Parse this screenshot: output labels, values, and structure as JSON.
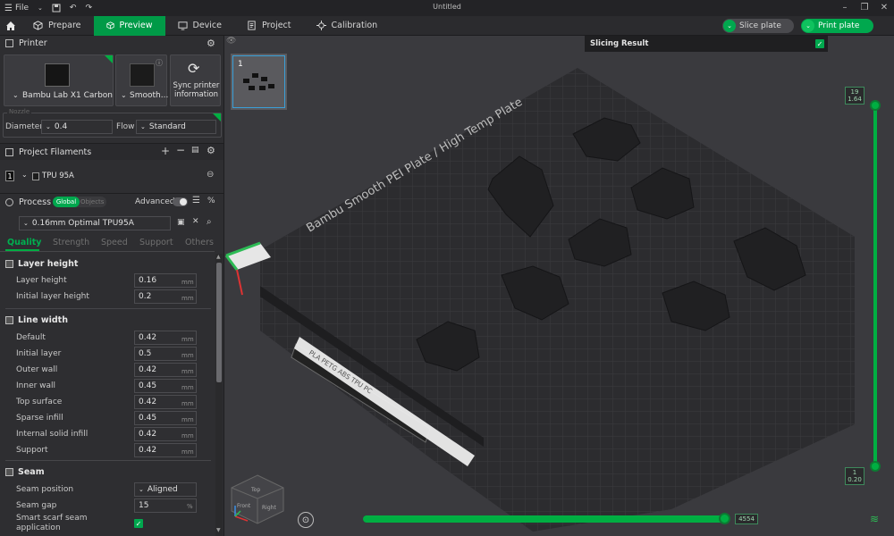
{
  "app": {
    "window_title": "Untitled",
    "file_menu_label": "File"
  },
  "toolbar": {
    "tabs": [
      {
        "label": "Prepare",
        "icon": "cube-icon"
      },
      {
        "label": "Preview",
        "icon": "cube-icon"
      },
      {
        "label": "Device",
        "icon": "device-icon"
      },
      {
        "label": "Project",
        "icon": "project-icon"
      },
      {
        "label": "Calibration",
        "icon": "calibration-icon"
      }
    ],
    "active_tab": "Preview",
    "slice_plate_label": "Slice plate",
    "print_plate_label": "Print plate"
  },
  "printer": {
    "section_title": "Printer",
    "printer_name": "Bambu Lab X1 Carbon",
    "plate_name": "Smooth...",
    "sync_label": "Sync printer information",
    "nozzle_label": "Nozzle",
    "diameter_label": "Diameter",
    "diameter_value": "0.4",
    "flow_label": "Flow",
    "flow_value": "Standard"
  },
  "filaments": {
    "section_title": "Project Filaments",
    "items": [
      {
        "index": "1",
        "name": "TPU 95A"
      }
    ]
  },
  "process": {
    "section_title": "Process",
    "toggle_global": "Global",
    "toggle_objects": "Objects",
    "advanced_label": "Advanced",
    "profile": "0.16mm Optimal TPU95A",
    "subtabs": [
      "Quality",
      "Strength",
      "Speed",
      "Support",
      "Others"
    ],
    "active_subtab": "Quality",
    "groups": [
      {
        "title": "Layer height",
        "rows": [
          {
            "label": "Layer height",
            "value": "0.16",
            "unit": "mm"
          },
          {
            "label": "Initial layer height",
            "value": "0.2",
            "unit": "mm"
          }
        ]
      },
      {
        "title": "Line width",
        "rows": [
          {
            "label": "Default",
            "value": "0.42",
            "unit": "mm"
          },
          {
            "label": "Initial layer",
            "value": "0.5",
            "unit": "mm"
          },
          {
            "label": "Outer wall",
            "value": "0.42",
            "unit": "mm"
          },
          {
            "label": "Inner wall",
            "value": "0.45",
            "unit": "mm"
          },
          {
            "label": "Top surface",
            "value": "0.42",
            "unit": "mm"
          },
          {
            "label": "Sparse infill",
            "value": "0.45",
            "unit": "mm"
          },
          {
            "label": "Internal solid infill",
            "value": "0.42",
            "unit": "mm"
          },
          {
            "label": "Support",
            "value": "0.42",
            "unit": "mm"
          }
        ]
      },
      {
        "title": "Seam",
        "rows": [
          {
            "label": "Seam position",
            "value": "Aligned",
            "unit": ""
          },
          {
            "label": "Seam gap",
            "value": "15",
            "unit": "%"
          },
          {
            "label": "Smart scarf seam application",
            "value": "",
            "unit": ""
          }
        ]
      }
    ]
  },
  "viewport": {
    "plate_thumb_number": "1",
    "plate_text": "Bambu Smooth PEI Plate / High Temp Plate",
    "plate_side_text": "PLA PETG ABS TPU PC",
    "slicing_result_label": "Slicing Result",
    "layer_top": "19",
    "layer_top_height": "1.64",
    "layer_bottom": "1",
    "layer_bottom_height": "0.20",
    "move_slider_value": "4554",
    "move_slider_fraction": 1.0,
    "view_cube_top": "Top",
    "view_cube_front": "Front",
    "view_cube_right": "Right"
  },
  "colors": {
    "accent": "#00AE42",
    "panel_bg": "#2E2E31",
    "viewport_bg": "#3A3A3E"
  }
}
